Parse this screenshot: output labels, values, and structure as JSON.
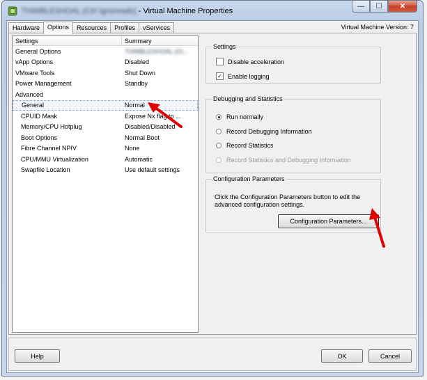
{
  "window": {
    "title_blurred": "THIMBLESHOAL (Ctrl Ignoreado)",
    "title": "- Virtual Machine Properties",
    "controls": {
      "minimize": "—",
      "maximize": "☐",
      "close": "✕"
    }
  },
  "tabs": [
    {
      "label": "Hardware"
    },
    {
      "label": "Options"
    },
    {
      "label": "Resources"
    },
    {
      "label": "Profiles"
    },
    {
      "label": "vServices"
    }
  ],
  "active_tab": "Options",
  "vm_version": "Virtual Machine Version: 7",
  "settings_list": {
    "headers": {
      "settings": "Settings",
      "summary": "Summary"
    },
    "rows": [
      {
        "setting": "General Options",
        "summary": "THIMBLESHOAL (Ct...",
        "blurred": true,
        "indent": false
      },
      {
        "setting": "vApp Options",
        "summary": "Disabled",
        "indent": false
      },
      {
        "setting": "VMware Tools",
        "summary": "Shut Down",
        "indent": false
      },
      {
        "setting": "Power Management",
        "summary": "Standby",
        "indent": false
      },
      {
        "setting": "Advanced",
        "summary": "",
        "indent": false
      },
      {
        "setting": "General",
        "summary": "Normal",
        "indent": true,
        "selected": true
      },
      {
        "setting": "CPUID Mask",
        "summary": "Expose Nx flag to ...",
        "indent": true
      },
      {
        "setting": "Memory/CPU Hotplug",
        "summary": "Disabled/Disabled",
        "indent": true
      },
      {
        "setting": "Boot Options",
        "summary": "Normal Boot",
        "indent": true
      },
      {
        "setting": "Fibre Channel NPIV",
        "summary": "None",
        "indent": true
      },
      {
        "setting": "CPU/MMU Virtualization",
        "summary": "Automatic",
        "indent": true
      },
      {
        "setting": "Swapfile Location",
        "summary": "Use default settings",
        "indent": true
      }
    ]
  },
  "settings_group": {
    "title": "Settings",
    "disable_acceleration": {
      "label": "Disable acceleration",
      "checked": false
    },
    "enable_logging": {
      "label": "Enable logging",
      "checked": true
    }
  },
  "debugging_group": {
    "title": "Debugging and Statistics",
    "options": [
      {
        "label": "Run normally",
        "selected": true,
        "enabled": true
      },
      {
        "label": "Record Debugging Information",
        "selected": false,
        "enabled": true
      },
      {
        "label": "Record Statistics",
        "selected": false,
        "enabled": true
      },
      {
        "label": "Record Statistics and Debugging Information",
        "selected": false,
        "enabled": false
      }
    ]
  },
  "config_group": {
    "title": "Configuration Parameters",
    "description": "Click the Configuration Parameters button to edit the advanced configuration settings.",
    "button_label": "Configuration Parameters..."
  },
  "footer": {
    "help": "Help",
    "ok": "OK",
    "cancel": "Cancel"
  },
  "annotation_color": "#e00000",
  "chrome_colors": {
    "title_bar": "#c9d9ee",
    "panel": "#f0f0f0",
    "close_button": "#c8412a"
  }
}
